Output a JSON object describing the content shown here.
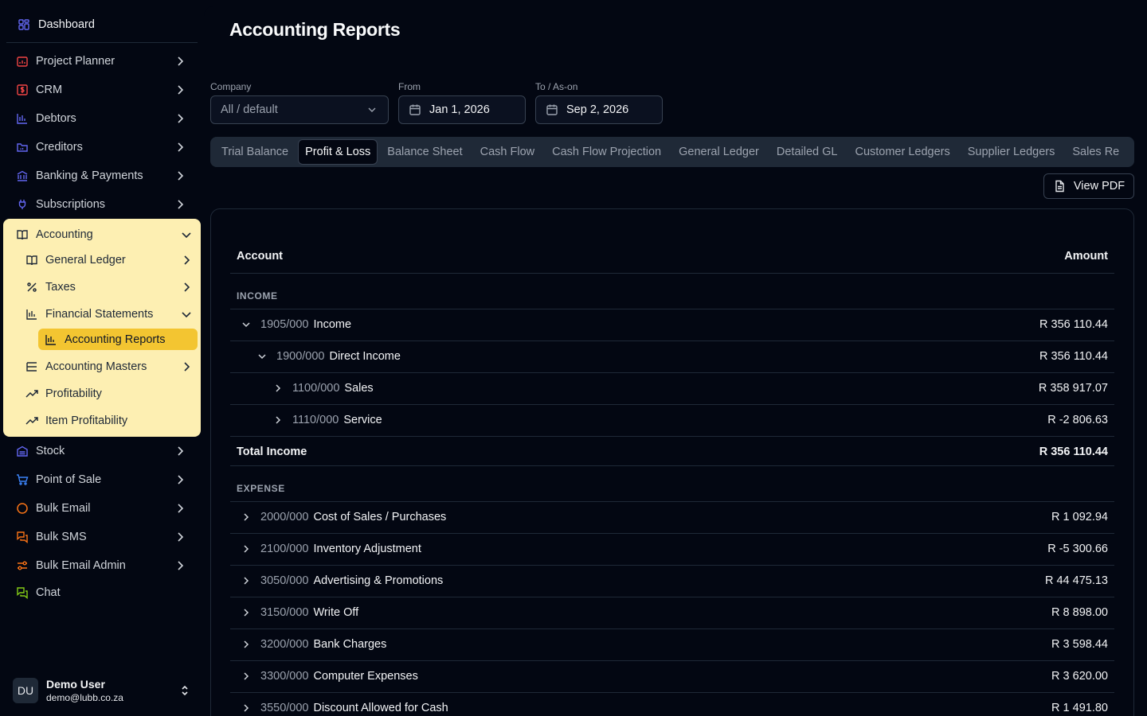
{
  "sidebar": {
    "dashboard": "Dashboard",
    "items": [
      {
        "label": "Project Planner"
      },
      {
        "label": "CRM"
      },
      {
        "label": "Debtors"
      },
      {
        "label": "Creditors"
      },
      {
        "label": "Banking & Payments"
      },
      {
        "label": "Subscriptions"
      }
    ],
    "accounting": {
      "label": "Accounting",
      "children": [
        {
          "label": "General Ledger"
        },
        {
          "label": "Taxes"
        },
        {
          "label": "Financial Statements"
        },
        {
          "label": "Accounting Reports"
        },
        {
          "label": "Accounting Masters"
        },
        {
          "label": "Profitability"
        },
        {
          "label": "Item Profitability"
        }
      ]
    },
    "items_after": [
      {
        "label": "Stock"
      },
      {
        "label": "Point of Sale"
      },
      {
        "label": "Bulk Email"
      },
      {
        "label": "Bulk SMS"
      },
      {
        "label": "Bulk Email Admin"
      },
      {
        "label": "Chat"
      }
    ],
    "user": {
      "initials": "DU",
      "name": "Demo User",
      "email": "demo@lubb.co.za"
    }
  },
  "header": {
    "title": "Accounting Reports"
  },
  "filters": {
    "company_label": "Company",
    "company_value": "All / default",
    "from_label": "From",
    "from_value": "Jan 1, 2026",
    "to_label": "To / As-on",
    "to_value": "Sep 2, 2026"
  },
  "tabs": [
    "Trial Balance",
    "Profit & Loss",
    "Balance Sheet",
    "Cash Flow",
    "Cash Flow Projection",
    "General Ledger",
    "Detailed GL",
    "Customer Ledgers",
    "Supplier Ledgers",
    "Sales Re"
  ],
  "active_tab": "Profit & Loss",
  "actions": {
    "view_pdf": "View PDF"
  },
  "table": {
    "col_account": "Account",
    "col_amount": "Amount",
    "income_label": "INCOME",
    "income_rows": [
      {
        "code": "1905/000",
        "name": "Income",
        "amount": "R 356 110.44",
        "level": 0,
        "expanded": true
      },
      {
        "code": "1900/000",
        "name": "Direct Income",
        "amount": "R 356 110.44",
        "level": 1,
        "expanded": true
      },
      {
        "code": "1100/000",
        "name": "Sales",
        "amount": "R 358 917.07",
        "level": 2,
        "expanded": false
      },
      {
        "code": "1110/000",
        "name": "Service",
        "amount": "R -2 806.63",
        "level": 2,
        "expanded": false
      }
    ],
    "total_income_label": "Total Income",
    "total_income_amount": "R 356 110.44",
    "expense_label": "EXPENSE",
    "expense_rows": [
      {
        "code": "2000/000",
        "name": "Cost of Sales / Purchases",
        "amount": "R 1 092.94"
      },
      {
        "code": "2100/000",
        "name": "Inventory Adjustment",
        "amount": "R -5 300.66"
      },
      {
        "code": "3050/000",
        "name": "Advertising & Promotions",
        "amount": "R 44 475.13"
      },
      {
        "code": "3150/000",
        "name": "Write Off",
        "amount": "R 8 898.00"
      },
      {
        "code": "3200/000",
        "name": "Bank Charges",
        "amount": "R 3 598.44"
      },
      {
        "code": "3300/000",
        "name": "Computer Expenses",
        "amount": "R 3 620.00"
      },
      {
        "code": "3550/000",
        "name": "Discount Allowed for Cash",
        "amount": "R 1 491.80"
      }
    ]
  },
  "colors": {
    "accent": "#f3c531",
    "accent_bg": "#fdefb2",
    "bg": "#030712"
  }
}
